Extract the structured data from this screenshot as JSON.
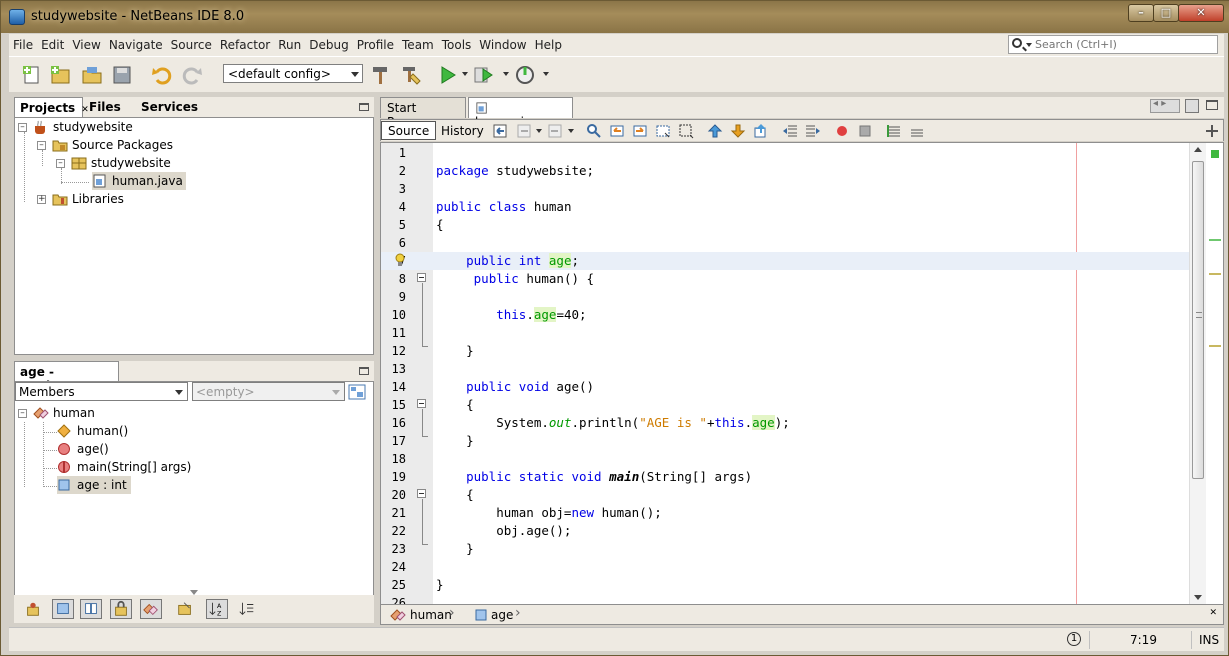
{
  "window": {
    "title": "studywebsite - NetBeans IDE 8.0",
    "buttons": [
      "minimize",
      "maximize",
      "close"
    ]
  },
  "menu": [
    "File",
    "Edit",
    "View",
    "Navigate",
    "Source",
    "Refactor",
    "Run",
    "Debug",
    "Profile",
    "Team",
    "Tools",
    "Window",
    "Help"
  ],
  "search": {
    "placeholder": "Search (Ctrl+I)"
  },
  "toolbar": {
    "config": "<default config>"
  },
  "projects_panel": {
    "tabs": [
      "Projects",
      "Files",
      "Services"
    ],
    "tree": [
      {
        "label": "studywebsite",
        "icon": "coffee-cup-icon",
        "level": 0
      },
      {
        "label": "Source Packages",
        "icon": "package-folder-icon",
        "level": 1
      },
      {
        "label": "studywebsite",
        "icon": "package-icon",
        "level": 2
      },
      {
        "label": "human.java",
        "icon": "java-file-icon",
        "level": 3,
        "selected": true
      },
      {
        "label": "Libraries",
        "icon": "library-folder-icon",
        "level": 1
      }
    ]
  },
  "navigator": {
    "title": "age - Navigator",
    "filter": "Members",
    "empty": "<empty>",
    "tree": [
      {
        "label": "human",
        "icon": "class-icon"
      },
      {
        "label": "human()",
        "icon": "constructor-icon"
      },
      {
        "label": "age()",
        "icon": "method-icon"
      },
      {
        "label": "main(String[] args)",
        "icon": "static-method-icon"
      },
      {
        "label": "age : int",
        "icon": "field-icon",
        "selected": true
      }
    ]
  },
  "editor": {
    "tabs": [
      {
        "label": "Start Page",
        "active": false
      },
      {
        "label": "human.java",
        "active": true
      }
    ],
    "modes": [
      "Source",
      "History"
    ],
    "current_line": 7,
    "lines": [
      "",
      "package studywebsite;",
      "",
      "public class human",
      "{",
      "",
      "    public int age;",
      "     public human() {",
      "",
      "        this.age=40;",
      "",
      "    }",
      "",
      "    public void age()",
      "    {",
      "        System.out.println(\"AGE is \"+this.age);",
      "    }",
      "",
      "    public static void main(String[] args)",
      "    {",
      "        human obj=new human();",
      "        obj.age();",
      "    }",
      "",
      "}",
      ""
    ],
    "line_numbers": [
      "1",
      "2",
      "3",
      "4",
      "5",
      "6",
      "7",
      "8",
      "9",
      "10",
      "11",
      "12",
      "13",
      "14",
      "15",
      "16",
      "17",
      "18",
      "19",
      "20",
      "21",
      "22",
      "23",
      "24",
      "25",
      "26"
    ]
  },
  "breadcrumb": [
    "human",
    "age"
  ],
  "status": {
    "notifications": "1",
    "position": "7:19",
    "mode": "INS"
  },
  "colors": {
    "keyword": "#0000e6",
    "string": "#ce7b00",
    "field": "#009900",
    "current_line": "#e9eff8",
    "title_bar": "#a58c5a"
  }
}
